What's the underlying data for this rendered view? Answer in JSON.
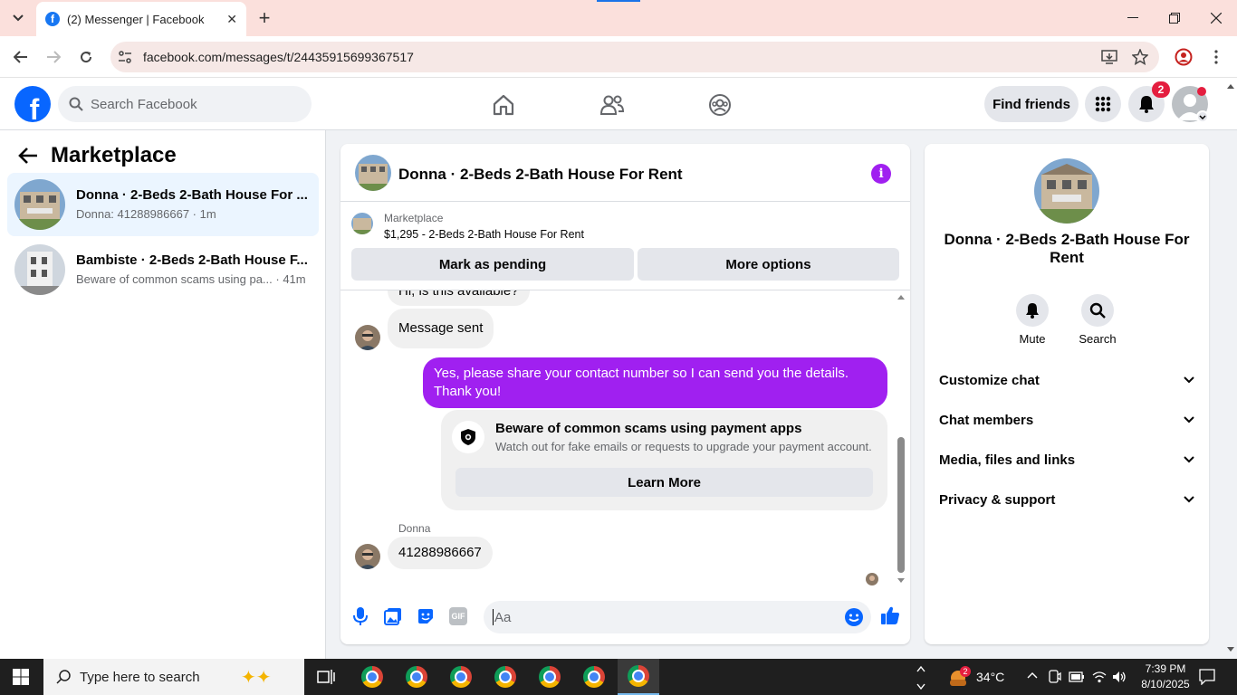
{
  "browser": {
    "tab_title": "(2) Messenger | Facebook",
    "url": "facebook.com/messages/t/24435915699367517"
  },
  "fb_header": {
    "logo": "f",
    "search_placeholder": "Search Facebook",
    "find_friends": "Find friends",
    "notification_count": "2"
  },
  "left_panel": {
    "title": "Marketplace",
    "conversations": [
      {
        "name": "Donna · 2-Beds 2-Bath House For ...",
        "preview": "Donna: 41288986667 · 1m",
        "active": true
      },
      {
        "name": "Bambiste · 2-Beds 2-Bath House F...",
        "preview": "Beware of common scams using pa... · 41m",
        "active": false
      }
    ]
  },
  "chat": {
    "title": "Donna · 2-Beds 2-Bath House For Rent",
    "marketplace_label": "Marketplace",
    "listing": "$1,295 - 2-Beds 2-Bath House For Rent",
    "mark_pending": "Mark as pending",
    "more_options": "More options",
    "messages": {
      "partial_top": "Hi, is this available?",
      "msg_sent": "Message sent",
      "outgoing": "Yes, please share your contact number so I can send you the details. Thank you!",
      "scam_title": "Beware of common scams using payment apps",
      "scam_body": "Watch out for fake emails or requests to upgrade your payment account.",
      "learn_more": "Learn More",
      "sender_name": "Donna",
      "incoming_number": "41288986667"
    },
    "composer_placeholder": "Aa"
  },
  "right_panel": {
    "name": "Donna · 2-Beds 2-Bath House For Rent",
    "actions": [
      {
        "label": "Mute",
        "icon": "bell-icon"
      },
      {
        "label": "Search",
        "icon": "search-icon"
      }
    ],
    "sections": [
      "Customize chat",
      "Chat members",
      "Media, files and links",
      "Privacy & support"
    ]
  },
  "taskbar": {
    "search_placeholder": "Type here to search",
    "weather": "34°C",
    "weather_badge": "2",
    "time": "7:39 PM",
    "date": "8/10/2025"
  },
  "colors": {
    "accent": "#a020f0",
    "fb_blue": "#0866ff",
    "tab_bg": "#fbe0dc"
  }
}
